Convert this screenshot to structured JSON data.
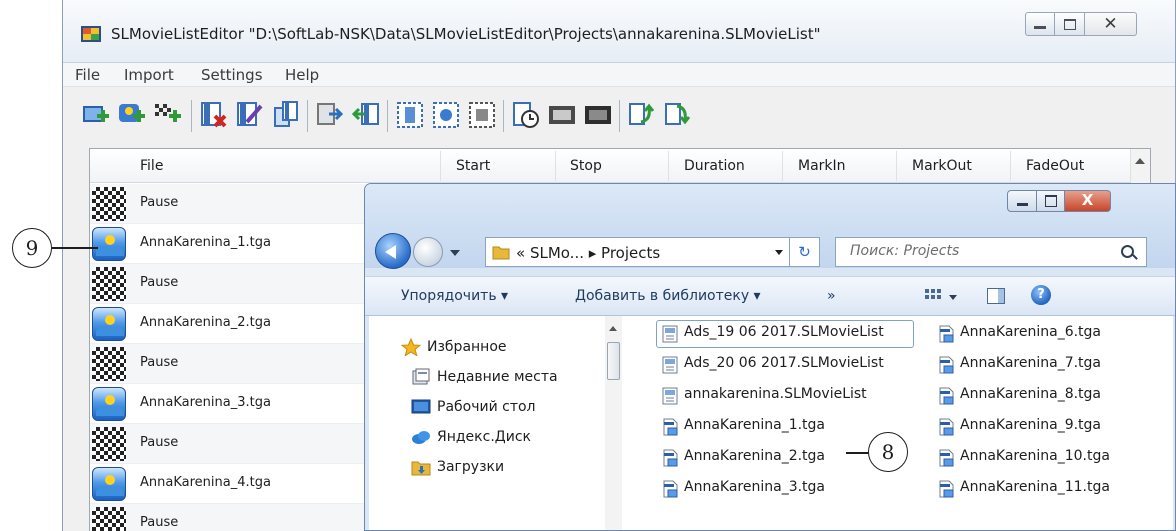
{
  "main_window": {
    "title": "SLMovieListEditor \"D:\\SoftLab-NSK\\Data\\SLMovieListEditor\\Projects\\annakarenina.SLMovieList\"",
    "caption_close": "✕",
    "menu": [
      "File",
      "Import",
      "Settings",
      "Help"
    ],
    "toolbar": [
      "add-clips-icon",
      "add-image-icon",
      "add-pause-icon",
      "delete-icon",
      "edit-icon",
      "copy-icon",
      "export-icon",
      "import-icon",
      "mark-in-icon",
      "mark-out-icon",
      "clear-marks-icon",
      "duration-icon",
      "filmstrip-icon",
      "filmstrip-dark-icon",
      "move-up-icon",
      "move-down-icon"
    ],
    "grid": {
      "columns": [
        "File",
        "Start",
        "Stop",
        "Duration",
        "MarkIn",
        "MarkOut",
        "FadeOut"
      ],
      "rows": [
        {
          "label": "Pause",
          "kind": "pause"
        },
        {
          "label": "AnnaKarenina_1.tga",
          "kind": "image"
        },
        {
          "label": "Pause",
          "kind": "pause"
        },
        {
          "label": "AnnaKarenina_2.tga",
          "kind": "image"
        },
        {
          "label": "Pause",
          "kind": "pause"
        },
        {
          "label": "AnnaKarenina_3.tga",
          "kind": "image"
        },
        {
          "label": "Pause",
          "kind": "pause"
        },
        {
          "label": "AnnaKarenina_4.tga",
          "kind": "image"
        },
        {
          "label": "Pause",
          "kind": "pause"
        }
      ]
    }
  },
  "dialog": {
    "caption_close": "X",
    "address": "« SLMo... ▸ Projects",
    "refresh_symbol": "↻",
    "search_placeholder": "Поиск: Projects",
    "commands": {
      "organize": "Упорядочить ▾",
      "add_to_library": "Добавить в библиотеку ▾",
      "more": "»"
    },
    "help_symbol": "?",
    "nav_items": [
      {
        "label": "Избранное",
        "icon": "star-icon"
      },
      {
        "label": "Недавние места",
        "icon": "recent-places-icon"
      },
      {
        "label": "Рабочий стол",
        "icon": "desktop-icon"
      },
      {
        "label": "Яндекс.Диск",
        "icon": "cloud-icon"
      },
      {
        "label": "Загрузки",
        "icon": "downloads-icon"
      }
    ],
    "files_col1": [
      {
        "name": "Ads_19 06 2017.SLMovieList",
        "kind": "list"
      },
      {
        "name": "Ads_20 06 2017.SLMovieList",
        "kind": "list"
      },
      {
        "name": "annakarenina.SLMovieList",
        "kind": "list"
      },
      {
        "name": "AnnaKarenina_1.tga",
        "kind": "tga"
      },
      {
        "name": "AnnaKarenina_2.tga",
        "kind": "tga"
      },
      {
        "name": "AnnaKarenina_3.tga",
        "kind": "tga"
      }
    ],
    "files_col2": [
      {
        "name": "AnnaKarenina_6.tga",
        "kind": "tga"
      },
      {
        "name": "AnnaKarenina_7.tga",
        "kind": "tga"
      },
      {
        "name": "AnnaKarenina_8.tga",
        "kind": "tga"
      },
      {
        "name": "AnnaKarenina_9.tga",
        "kind": "tga"
      },
      {
        "name": "AnnaKarenina_10.tga",
        "kind": "tga"
      },
      {
        "name": "AnnaKarenina_11.tga",
        "kind": "tga"
      }
    ]
  },
  "callouts": {
    "left": "9",
    "right": "8"
  }
}
